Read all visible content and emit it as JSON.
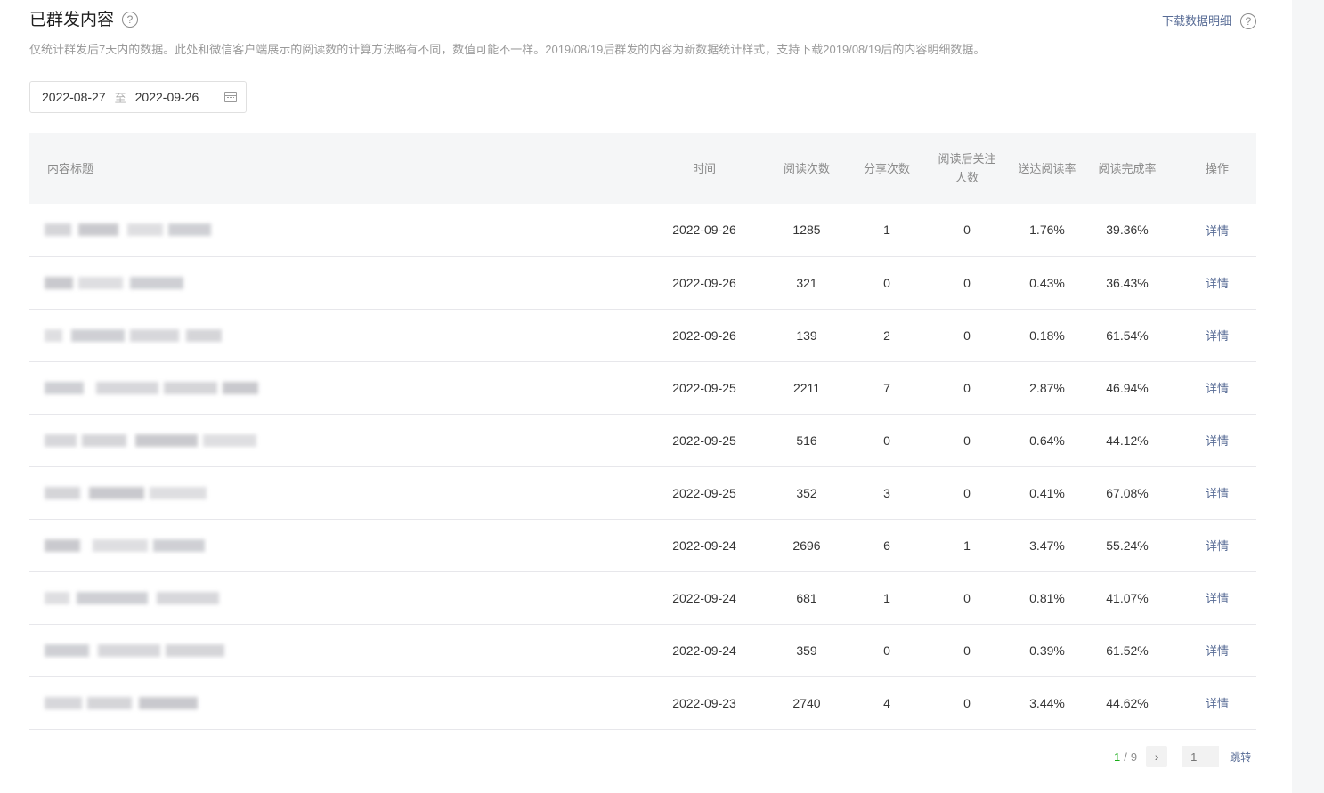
{
  "page": {
    "title": "已群发内容",
    "help_icon": "?",
    "download_label": "下载数据明细",
    "description": "仅统计群发后7天内的数据。此处和微信客户端展示的阅读数的计算方法略有不同，数值可能不一样。2019/08/19后群发的内容为新数据统计样式，支持下载2019/08/19后的内容明细数据。"
  },
  "date_range": {
    "start": "2022-08-27",
    "separator": "至",
    "end": "2022-09-26",
    "icon": "calendar-icon"
  },
  "table": {
    "columns": {
      "title": "内容标题",
      "time": "时间",
      "reads": "阅读次数",
      "shares": "分享次数",
      "follows": "阅读后关注人数",
      "delivery_rate": "送达阅读率",
      "completion_rate": "阅读完成率",
      "action": "操作"
    },
    "rows": [
      {
        "title": "（已模糊）",
        "time": "2022-09-26",
        "reads": "1285",
        "shares": "1",
        "follows": "0",
        "delivery_rate": "1.76%",
        "completion_rate": "39.36%",
        "action": "详情"
      },
      {
        "title": "（已模糊）",
        "time": "2022-09-26",
        "reads": "321",
        "shares": "0",
        "follows": "0",
        "delivery_rate": "0.43%",
        "completion_rate": "36.43%",
        "action": "详情"
      },
      {
        "title": "（已模糊）",
        "time": "2022-09-26",
        "reads": "139",
        "shares": "2",
        "follows": "0",
        "delivery_rate": "0.18%",
        "completion_rate": "61.54%",
        "action": "详情"
      },
      {
        "title": "（已模糊）",
        "time": "2022-09-25",
        "reads": "2211",
        "shares": "7",
        "follows": "0",
        "delivery_rate": "2.87%",
        "completion_rate": "46.94%",
        "action": "详情"
      },
      {
        "title": "（已模糊）",
        "time": "2022-09-25",
        "reads": "516",
        "shares": "0",
        "follows": "0",
        "delivery_rate": "0.64%",
        "completion_rate": "44.12%",
        "action": "详情"
      },
      {
        "title": "（已模糊）",
        "time": "2022-09-25",
        "reads": "352",
        "shares": "3",
        "follows": "0",
        "delivery_rate": "0.41%",
        "completion_rate": "67.08%",
        "action": "详情"
      },
      {
        "title": "（已模糊）",
        "time": "2022-09-24",
        "reads": "2696",
        "shares": "6",
        "follows": "1",
        "delivery_rate": "3.47%",
        "completion_rate": "55.24%",
        "action": "详情"
      },
      {
        "title": "（已模糊）",
        "time": "2022-09-24",
        "reads": "681",
        "shares": "1",
        "follows": "0",
        "delivery_rate": "0.81%",
        "completion_rate": "41.07%",
        "action": "详情"
      },
      {
        "title": "（已模糊）",
        "time": "2022-09-24",
        "reads": "359",
        "shares": "0",
        "follows": "0",
        "delivery_rate": "0.39%",
        "completion_rate": "61.52%",
        "action": "详情"
      },
      {
        "title": "（已模糊）",
        "time": "2022-09-23",
        "reads": "2740",
        "shares": "4",
        "follows": "0",
        "delivery_rate": "3.44%",
        "completion_rate": "44.62%",
        "action": "详情"
      }
    ]
  },
  "pagination": {
    "current": "1",
    "separator": "/",
    "total": "9",
    "next_icon": "chevron-right-icon",
    "input_placeholder": "1",
    "jump_label": "跳转"
  },
  "colors": {
    "link": "#576b95",
    "page_current": "#1aad19",
    "header_bg": "#f5f6f7",
    "muted_text": "#9a9a9a"
  }
}
